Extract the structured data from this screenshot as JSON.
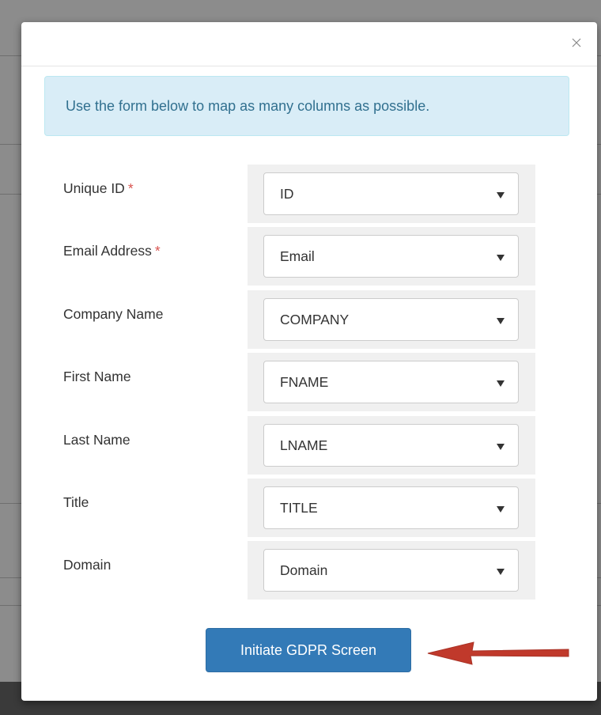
{
  "modal": {
    "close_glyph": "×",
    "info_message": "Use the form below to map as many columns as possible.",
    "fields": [
      {
        "label": "Unique ID",
        "required": "*",
        "value": "ID"
      },
      {
        "label": "Email Address",
        "required": "*",
        "value": "Email"
      },
      {
        "label": "Company Name",
        "required": "",
        "value": "COMPANY"
      },
      {
        "label": "First Name",
        "required": "",
        "value": "FNAME"
      },
      {
        "label": "Last Name",
        "required": "",
        "value": "LNAME"
      },
      {
        "label": "Title",
        "required": "",
        "value": "TITLE"
      },
      {
        "label": "Domain",
        "required": "",
        "value": "Domain"
      }
    ],
    "submit_label": "Initiate GDPR Screen"
  },
  "colors": {
    "primary_button": "#337ab7",
    "info_background": "#d9edf7",
    "info_text": "#31708f",
    "required": "#d9534f",
    "annotation_arrow": "#c0392b"
  },
  "icons": {
    "close": "close-icon",
    "select_caret": "caret-down-icon",
    "annotation": "red-arrow-icon"
  }
}
